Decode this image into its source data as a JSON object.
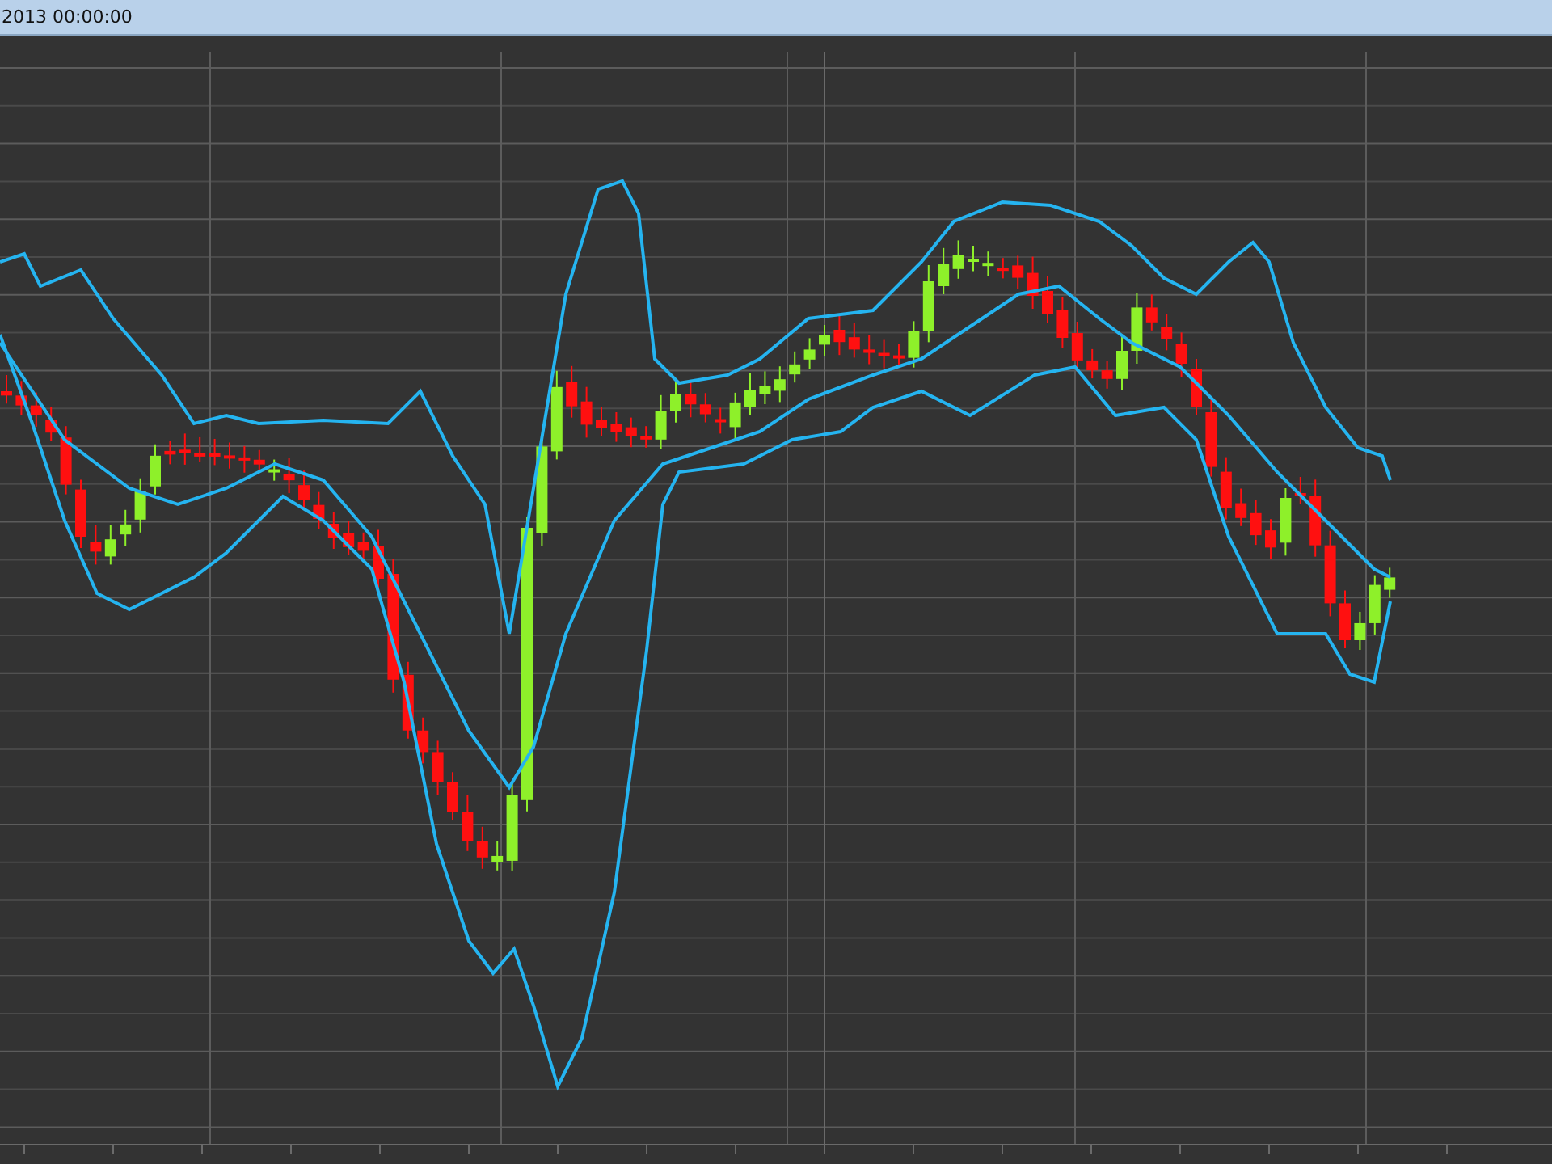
{
  "header": {
    "timestamp": "2013 00:00:00"
  }
}
